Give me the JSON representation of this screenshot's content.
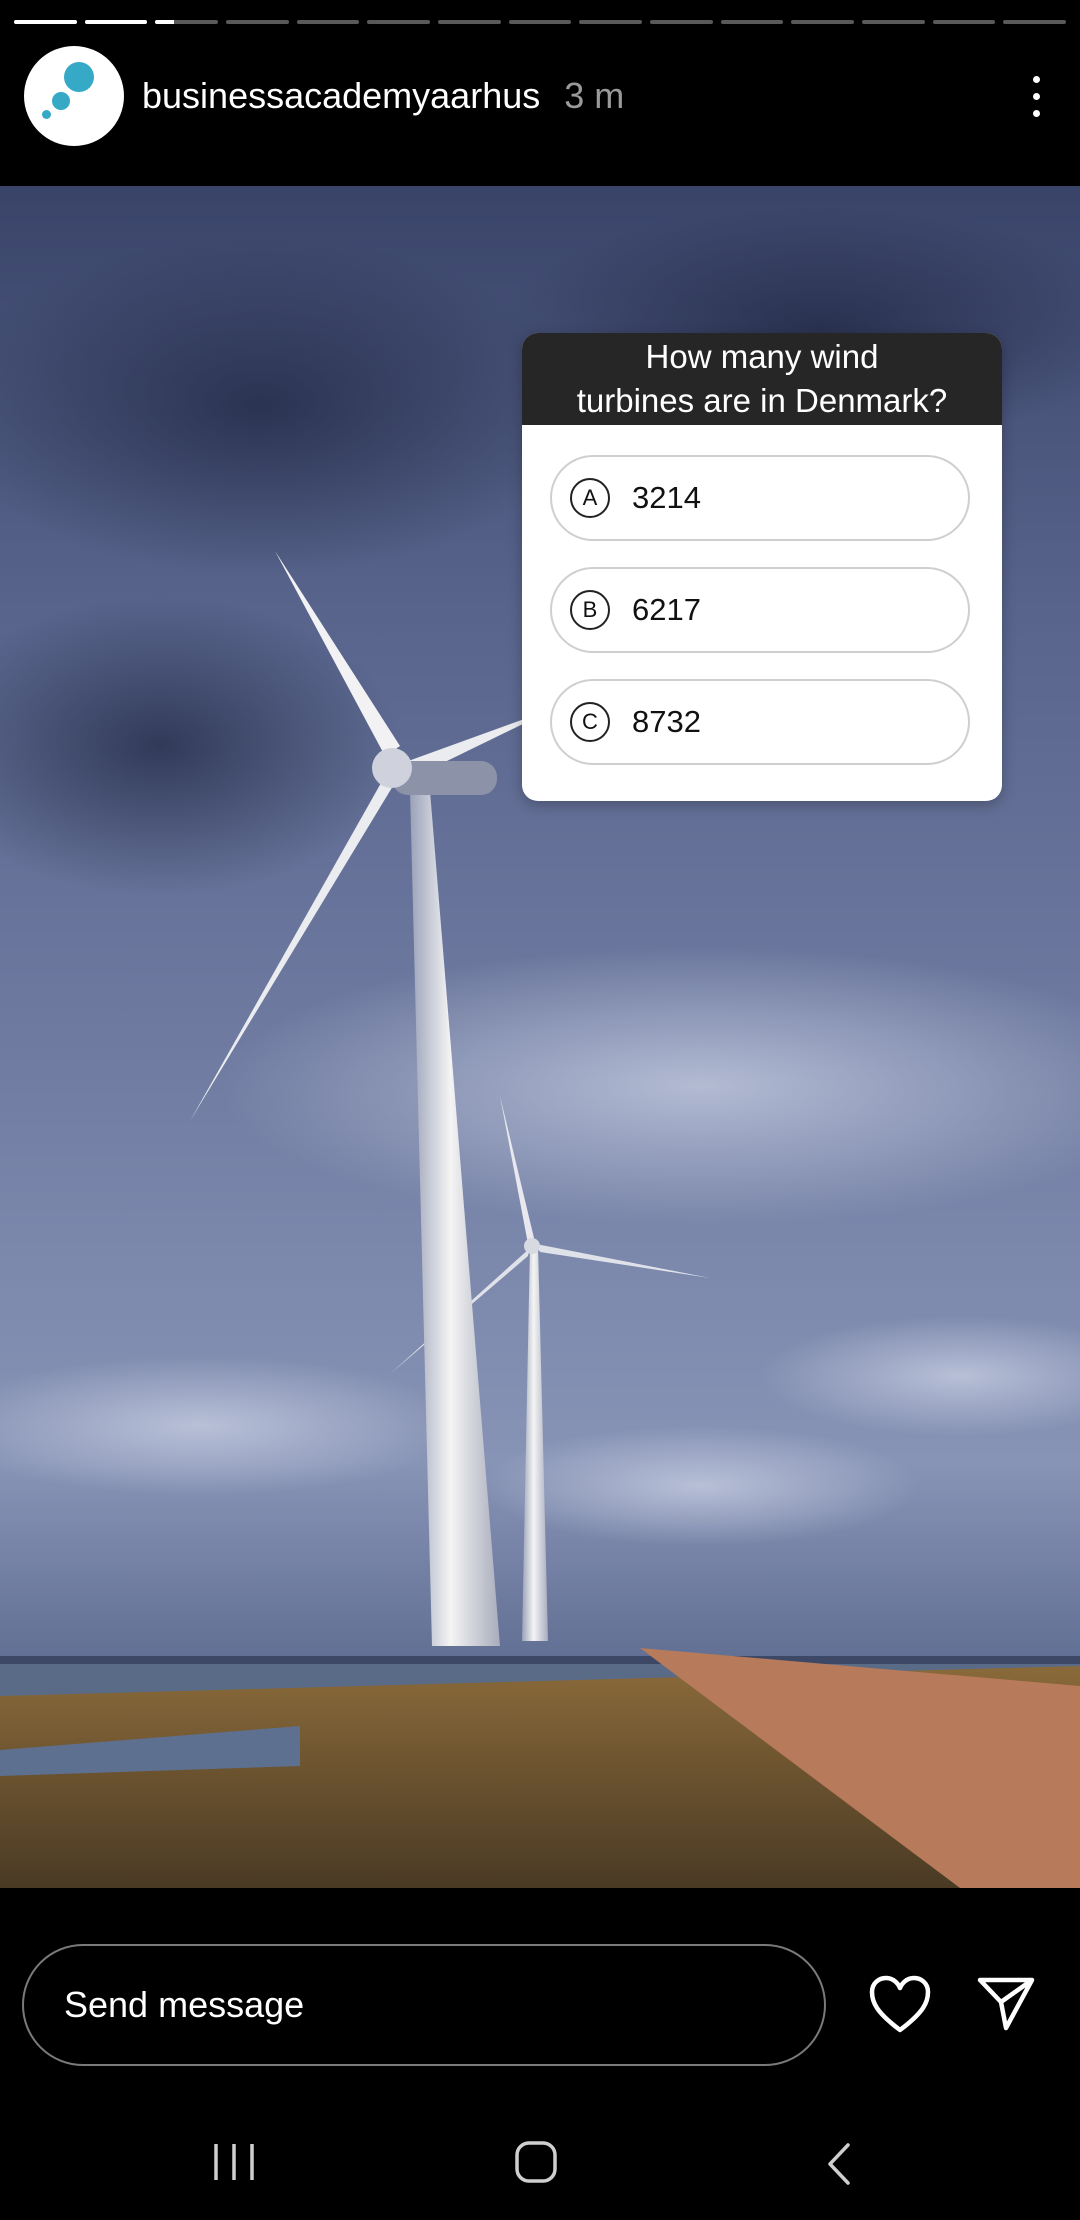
{
  "story": {
    "account_name": "businessacademyaarhus",
    "time_ago": "3 m",
    "progress": {
      "segments_total": 15,
      "segments_complete": 2,
      "current_segment_fraction": 0.3
    }
  },
  "quiz": {
    "question": "How many wind\nturbines are in Denmark?",
    "options": [
      {
        "letter": "A",
        "value": "3214"
      },
      {
        "letter": "B",
        "value": "6217"
      },
      {
        "letter": "C",
        "value": "8732"
      }
    ]
  },
  "footer": {
    "message_placeholder": "Send message"
  },
  "icons": {
    "more": "more-vertical-icon",
    "like": "heart-icon",
    "share": "send-icon",
    "nav_recents": "recents-icon",
    "nav_home": "home-icon",
    "nav_back": "back-icon"
  },
  "colors": {
    "avatar_accent": "#36a9c6",
    "quiz_header": "#262626"
  }
}
